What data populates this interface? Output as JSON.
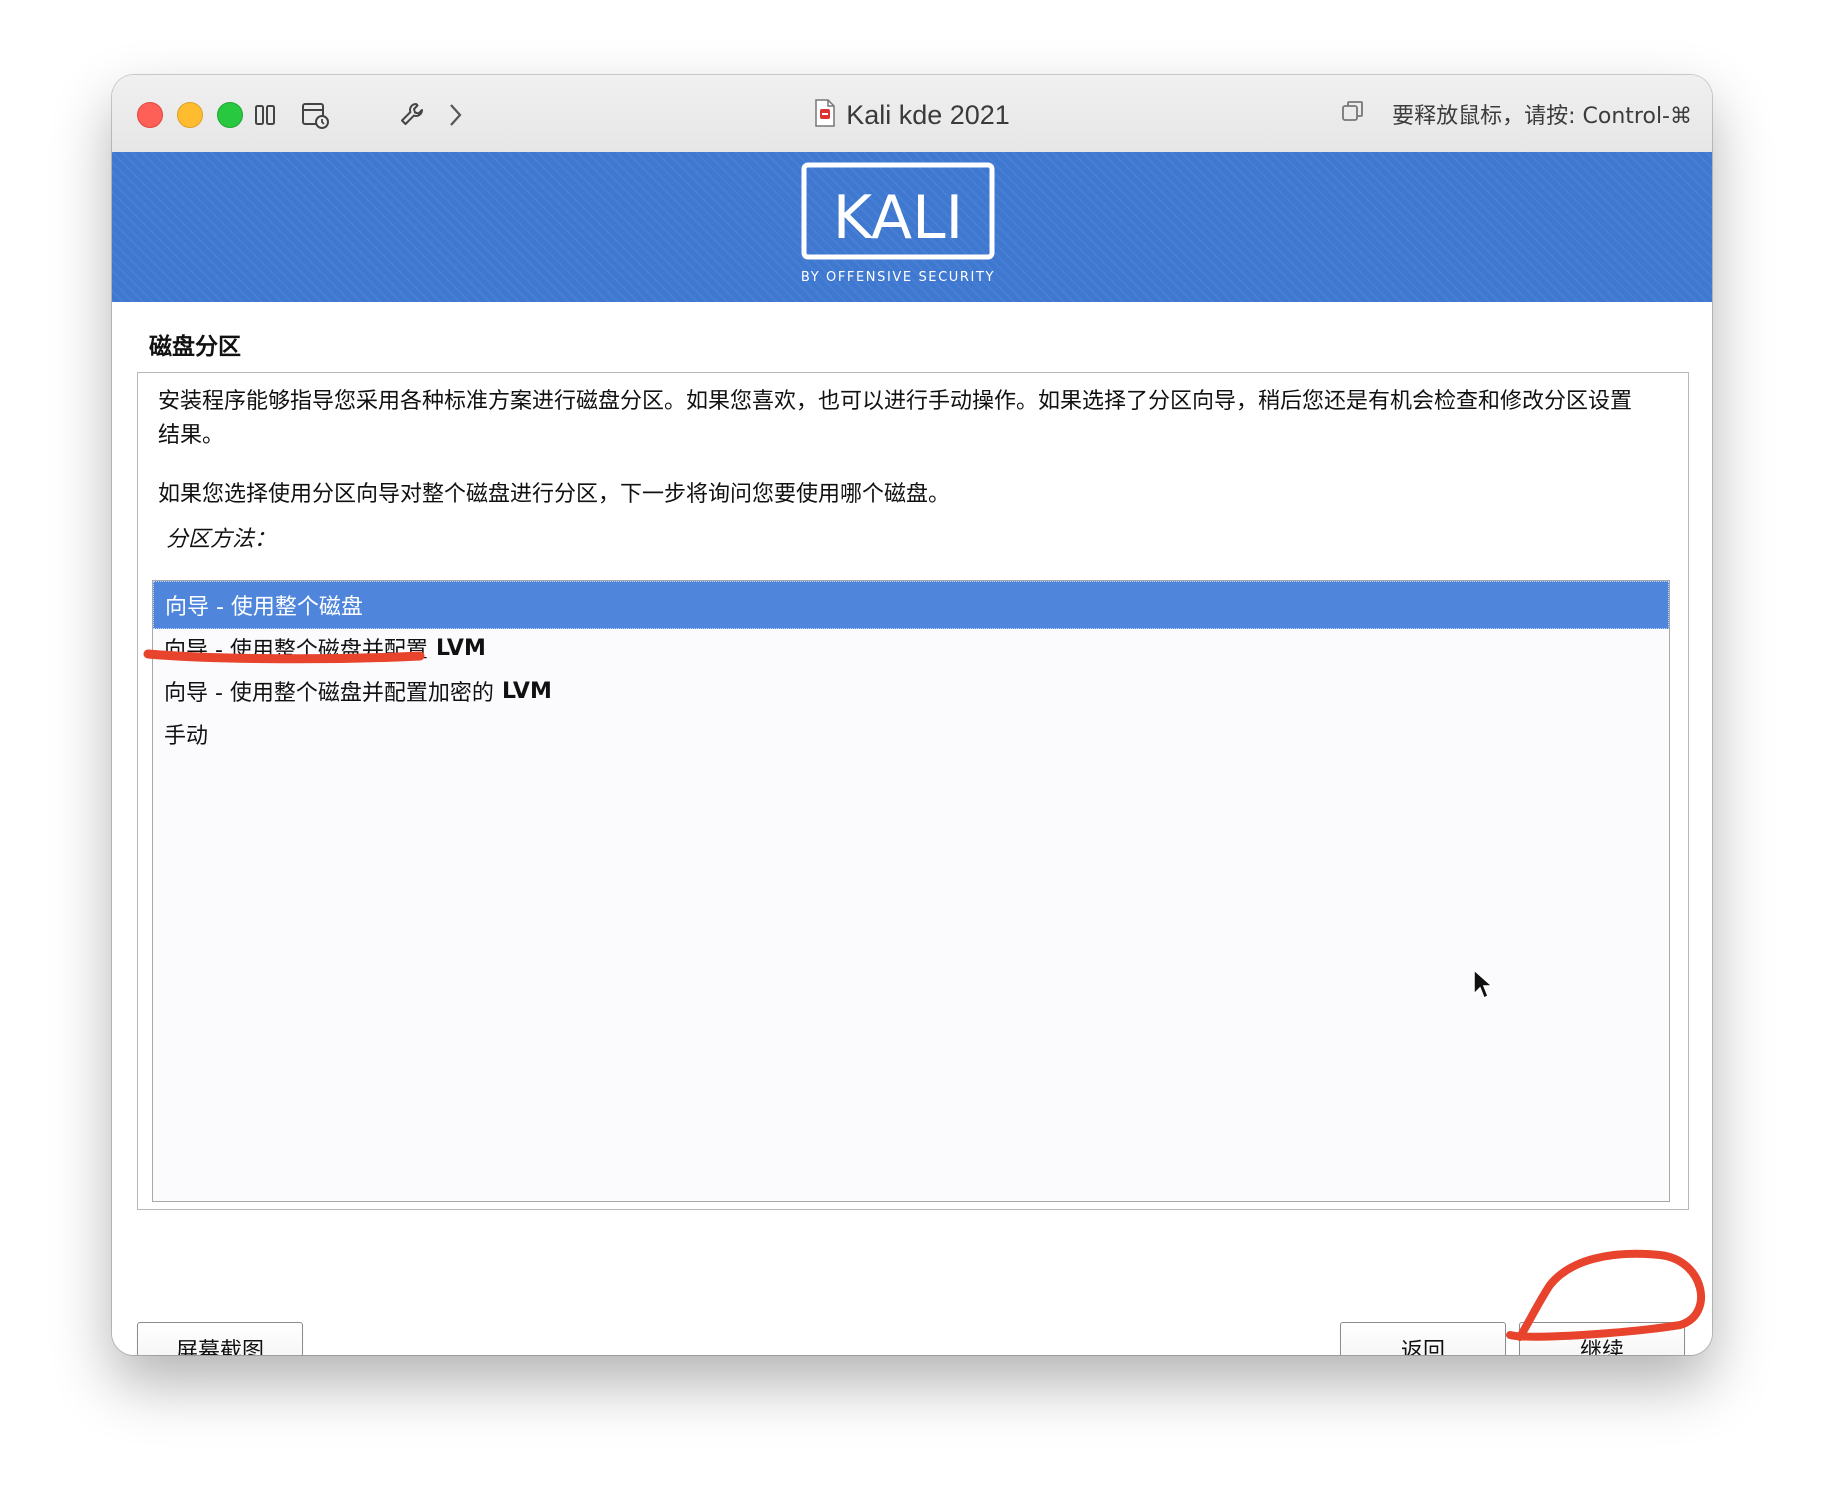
{
  "window": {
    "title": "Kali kde 2021",
    "release_hint": "要释放鼠标，请按: Control-⌘"
  },
  "banner": {
    "logo_text": "KALI",
    "logo_subtext": "BY OFFENSIVE SECURITY",
    "color": "#3f78d0"
  },
  "installer": {
    "page_title": "磁盘分区",
    "description_1": "安装程序能够指导您采用各种标准方案进行磁盘分区。如果您喜欢，也可以进行手动操作。如果选择了分区向导，稍后您还是有机会检查和修改分区设置结果。",
    "description_2": "如果您选择使用分区向导对整个磁盘进行分区，下一步将询问您要使用哪个磁盘。",
    "method_label": "分区方法：",
    "options": [
      {
        "label": "向导 - 使用整个磁盘",
        "suffix": "",
        "selected": true
      },
      {
        "label": "向导 - 使用整个磁盘并配置",
        "suffix": "LVM",
        "selected": false
      },
      {
        "label": "向导 - 使用整个磁盘并配置加密的",
        "suffix": "LVM",
        "selected": false
      },
      {
        "label": "手动",
        "suffix": "",
        "selected": false
      }
    ]
  },
  "buttons": {
    "screenshot": "屏幕截图",
    "back": "返回",
    "continue": "继续"
  },
  "colors": {
    "selection": "#4f86dc",
    "annotation": "#e8432d"
  },
  "icons": [
    "sidebar-toggle-icon",
    "snapshot-icon",
    "wrench-icon",
    "chevron-right-icon",
    "document-icon",
    "copy-icon",
    "mouse-cursor-icon"
  ]
}
